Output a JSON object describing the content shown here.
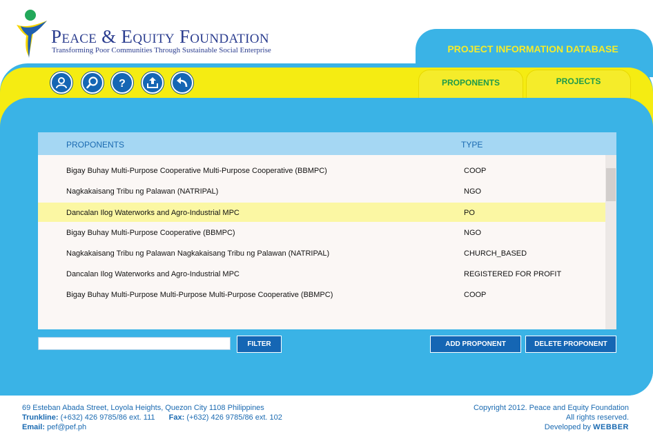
{
  "brand": {
    "name": "Peace & Equity Foundation",
    "tagline": "Transforming Poor Communities Through Sustainable Social Enterprise"
  },
  "header": {
    "db_title": "PROJECT INFORMATION DATABASE"
  },
  "toolbar": {
    "icons": [
      "user-icon",
      "search-icon",
      "help-icon",
      "upload-icon",
      "back-icon"
    ]
  },
  "tabs": [
    {
      "label": "PROPONENTS"
    },
    {
      "label": "PROJECTS"
    }
  ],
  "table": {
    "columns": [
      "PROPONENTS",
      "TYPE"
    ],
    "rows": [
      {
        "name": "Bigay Buhay Multi-Purpose  Cooperative  Multi-Purpose Cooperative (BBMPC)",
        "type": "COOP"
      },
      {
        "name": "Nagkakaisang Tribu ng Palawan (NATRIPAL)",
        "type": "NGO"
      },
      {
        "name": "Dancalan Ilog Waterworks and Agro-Industrial MPC",
        "type": "PO"
      },
      {
        "name": "Bigay Buhay Multi-Purpose  Cooperative (BBMPC)",
        "type": "NGO"
      },
      {
        "name": "Nagkakaisang Tribu ng Palawan Nagkakaisang Tribu ng Palawan (NATRIPAL)",
        "type": "CHURCH_BASED"
      },
      {
        "name": "Dancalan Ilog Waterworks and Agro-Industrial MPC",
        "type": "REGISTERED FOR PROFIT"
      },
      {
        "name": "Bigay Buhay Multi-Purpose Multi-Purpose  Multi-Purpose Cooperative (BBMPC)",
        "type": "COOP"
      }
    ],
    "selected_row": 2
  },
  "controls": {
    "filter_value": "",
    "filter_label": "FILTER",
    "add_label": "ADD PROPONENT",
    "delete_label": "DELETE PROPONENT"
  },
  "footer": {
    "address": "69 Esteban Abada Street, Loyola Heights, Quezon City 1108 Philippines",
    "trunkline_label": "Trunkline:",
    "trunkline": "(+632) 426 9785/86 ext. 111",
    "fax_label": "Fax:",
    "fax": "(+632) 426 9785/86 ext. 102",
    "email_label": "Email:",
    "email": "pef@pef.ph",
    "copyright": "Copyright 2012. Peace and Equity Foundation",
    "rights": "All rights reserved.",
    "developed_by": "Developed by",
    "developer": "WEBBER"
  },
  "colors": {
    "frame_blue": "#3ab3e6",
    "band_yellow": "#f5ec12",
    "button_blue": "#1566b4",
    "header_row": "#a5d7f3",
    "highlight_row": "#fbf7a3",
    "brand_navy": "#2b3d8f",
    "tab_text_green": "#1e9a4a"
  }
}
